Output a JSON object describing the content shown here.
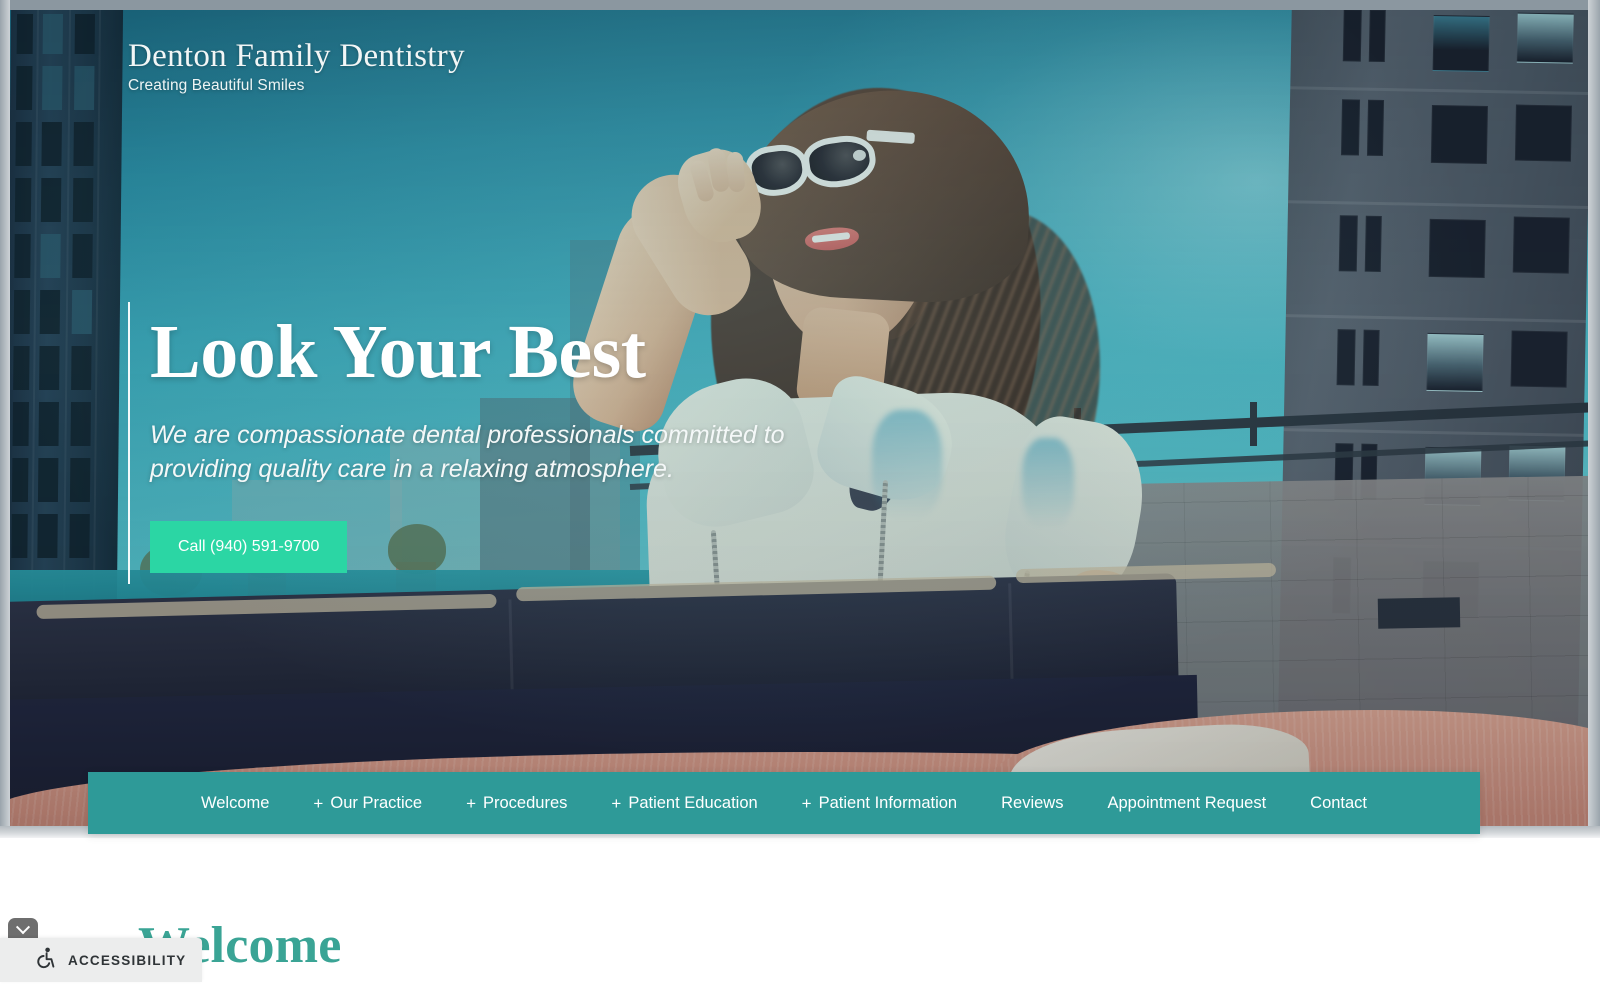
{
  "site": {
    "logo_title": "Denton Family Dentistry",
    "logo_tagline": "Creating Beautiful Smiles"
  },
  "hero": {
    "heading": "Look Your Best",
    "subheading": "We are compassionate dental professionals committed to providing quality care in a relaxing atmosphere.",
    "cta_label": "Call (940) 591-9700",
    "phone": "(940) 591-9700"
  },
  "nav": {
    "items": [
      {
        "label": "Welcome",
        "expandable": false
      },
      {
        "label": "Our Practice",
        "expandable": true
      },
      {
        "label": "Procedures",
        "expandable": true
      },
      {
        "label": "Patient Education",
        "expandable": true
      },
      {
        "label": "Patient Information",
        "expandable": true
      },
      {
        "label": "Reviews",
        "expandable": false
      },
      {
        "label": "Appointment Request",
        "expandable": false
      },
      {
        "label": "Contact",
        "expandable": false
      }
    ],
    "expand_marker": "+"
  },
  "content": {
    "welcome_heading": "Welcome"
  },
  "accessibility_widget": {
    "label": "ACCESSIBILITY",
    "icon": "wheelchair-icon",
    "collapse_icon": "chevron-down-icon"
  },
  "colors": {
    "nav_teal": "#2e9a98",
    "cta_green": "#2bd6a4",
    "heading_teal": "#3aa495",
    "hero_sky": "#2a8da3",
    "widget_bg": "#eceded",
    "widget_toggle": "#6e6e6e"
  }
}
